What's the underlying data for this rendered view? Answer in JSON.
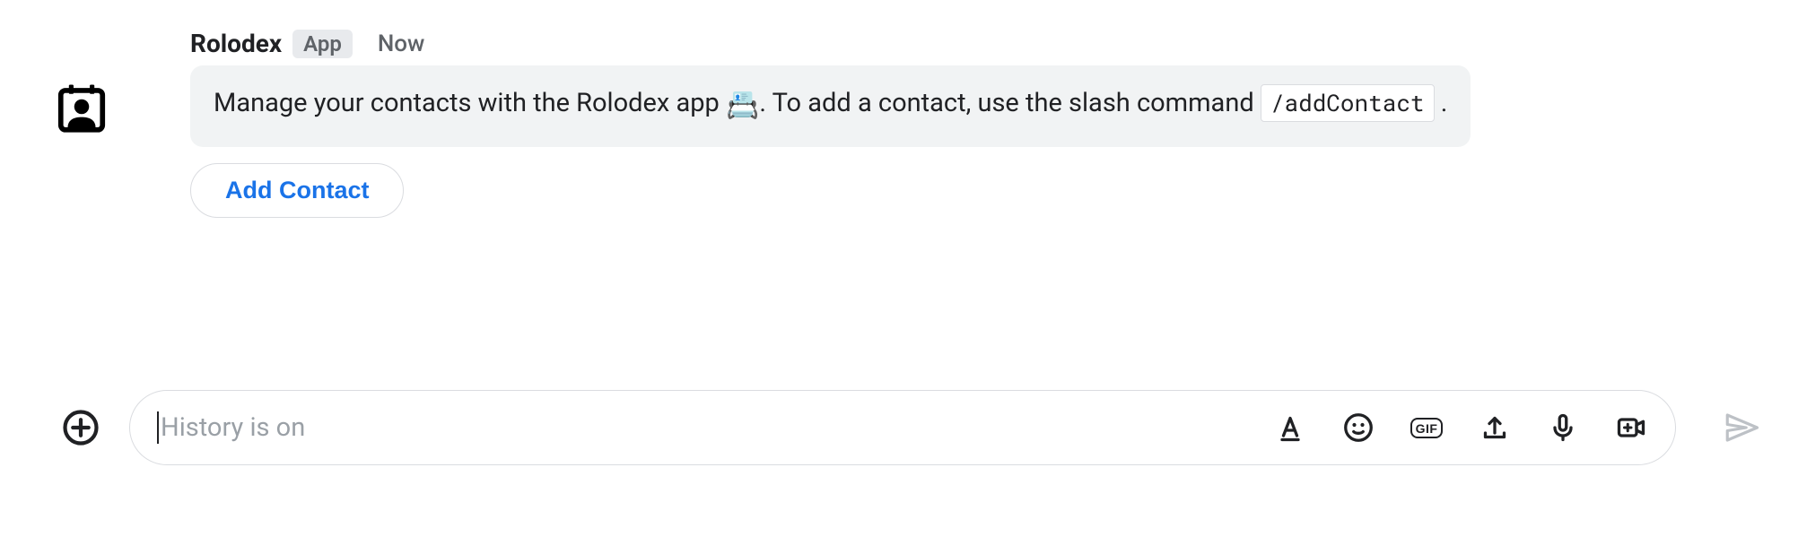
{
  "message": {
    "sender_name": "Rolodex",
    "app_badge": "App",
    "timestamp": "Now",
    "body_prefix": "Manage your contacts with the Rolodex app ",
    "body_emoji": "📇",
    "body_mid": ". To add a contact, use the slash command ",
    "slash_command": "/addContact",
    "body_suffix": ".",
    "action_button_label": "Add Contact"
  },
  "compose": {
    "placeholder": "History is on",
    "gif_label": "GIF"
  }
}
